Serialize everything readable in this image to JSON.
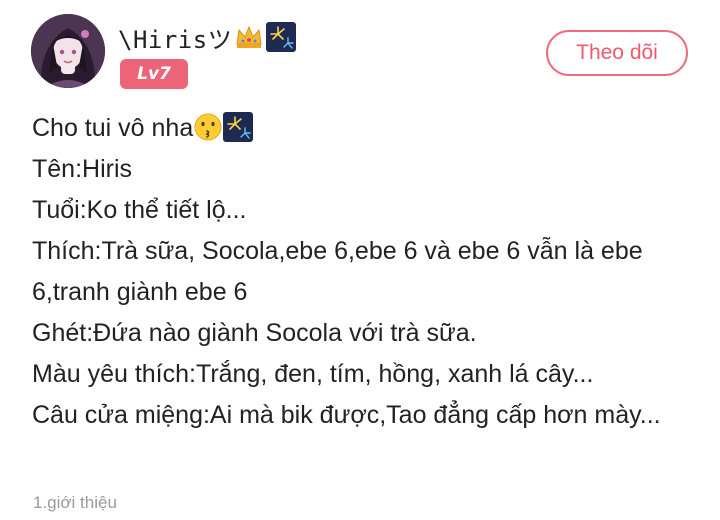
{
  "header": {
    "username": "\\Hirisツ",
    "level_badge": "Lv7",
    "follow_label": "Theo dõi"
  },
  "post": {
    "line1": "Cho tui vô nha",
    "line2": "Tên:Hiris",
    "line3": "Tuổi:Ko thể tiết lộ...",
    "line4": "Thích:Trà sữa, Socola,ebe 6,ebe 6 và ebe 6 vẫn là ebe 6,tranh giành ebe 6",
    "line5": "Ghét:Đứa nào giành Socola với trà sữa.",
    "line6": "Màu yêu thích:Trắng, đen, tím, hồng, xanh lá cây...",
    "line7": "Câu cửa miệng:Ai mà bik được,Tao đẳng cấp hơn mày..."
  },
  "footer": {
    "tag": "1.giới thiệu"
  },
  "colors": {
    "accent": "#ec6477",
    "follow_border": "#ee6b7c",
    "muted_text": "#9a9a9a"
  },
  "icons": [
    "crown-emoji-icon",
    "fireworks-emoji-icon",
    "kissing-face-emoji-icon"
  ]
}
